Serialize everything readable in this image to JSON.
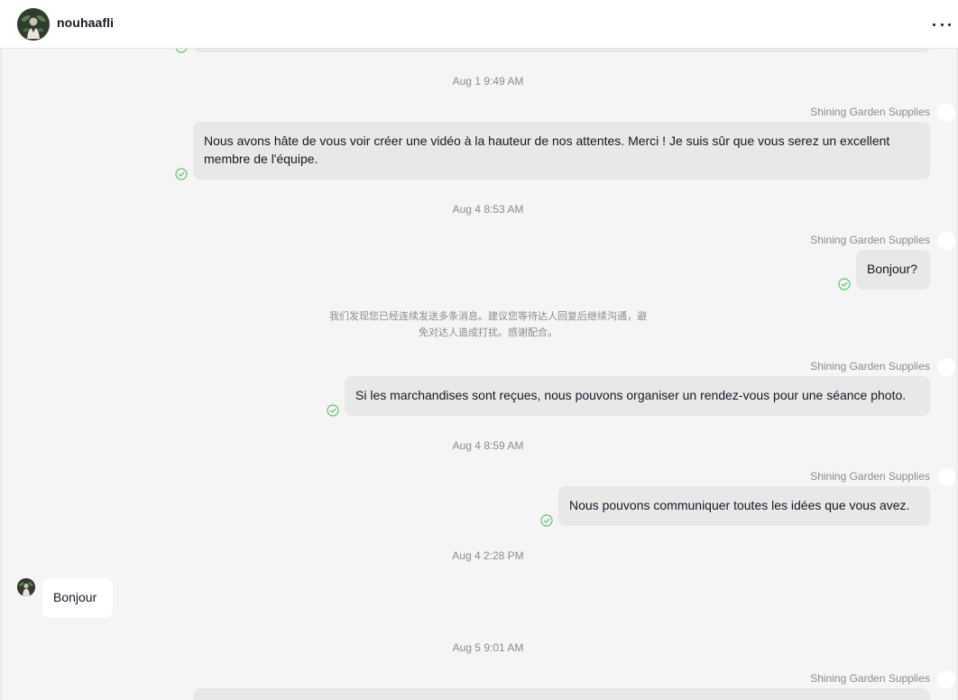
{
  "header": {
    "contact_name": "nouhaafli",
    "avatar_icon": "user-avatar-icon",
    "more_icon": "more-options-icon"
  },
  "conversation": {
    "sender_name": "Shining Garden Supplies",
    "timestamps": [
      "Aug 1 9:49 AM",
      "Aug 4 8:53 AM",
      "Aug 4 8:59 AM",
      "Aug 4 2:28 PM",
      "Aug 5 9:01 AM"
    ],
    "messages": [
      {
        "text": "Nous avons hâte de vous voir créer une vidéo à la hauteur de nos attentes. Merci ! Je suis sûr que vous serez un excellent membre de l'équipe.",
        "direction": "outgoing",
        "status": "read"
      },
      {
        "text": "Bonjour?",
        "direction": "outgoing",
        "status": "read"
      },
      {
        "text": "Si les marchandises sont reçues, nous pouvons organiser un rendez-vous pour une séance photo.",
        "direction": "outgoing",
        "status": "read"
      },
      {
        "text": "Nous pouvons communiquer toutes les idées que vous avez.",
        "direction": "outgoing",
        "status": "read"
      },
      {
        "text": "Bonjour",
        "direction": "incoming"
      }
    ],
    "system_note": "我们发现您已经连续发送多条消息。建议您等待达人回复后继续沟通，避免对达人造成打扰。感谢配合。"
  },
  "colors": {
    "outgoing_bubble": "#e8e8e9",
    "incoming_bubble": "#ffffff",
    "chat_background": "#f5f5f6",
    "read_check": "#5ec26a",
    "meta_text": "#8a8b91"
  }
}
